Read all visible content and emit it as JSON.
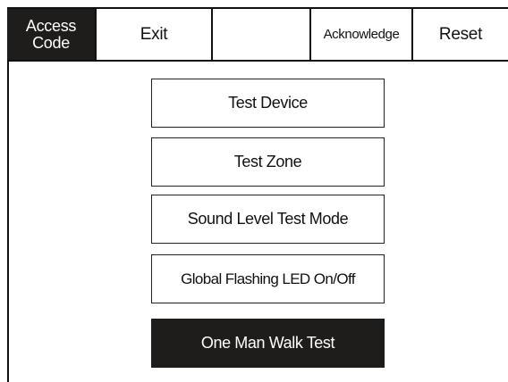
{
  "toolbar": {
    "access_code": "Access\nCode",
    "exit": "Exit",
    "blank": "",
    "acknowledge": "Acknowledge",
    "reset": "Reset"
  },
  "menu": {
    "test_device": "Test Device",
    "test_zone": "Test Zone",
    "sound_level_test_mode": "Sound Level Test Mode",
    "global_flashing_led": "Global Flashing LED On/Off",
    "one_man_walk_test": "One Man Walk Test"
  },
  "colors": {
    "dark_fill": "#1f1d1c",
    "line": "#111111",
    "background": "#ffffff"
  }
}
